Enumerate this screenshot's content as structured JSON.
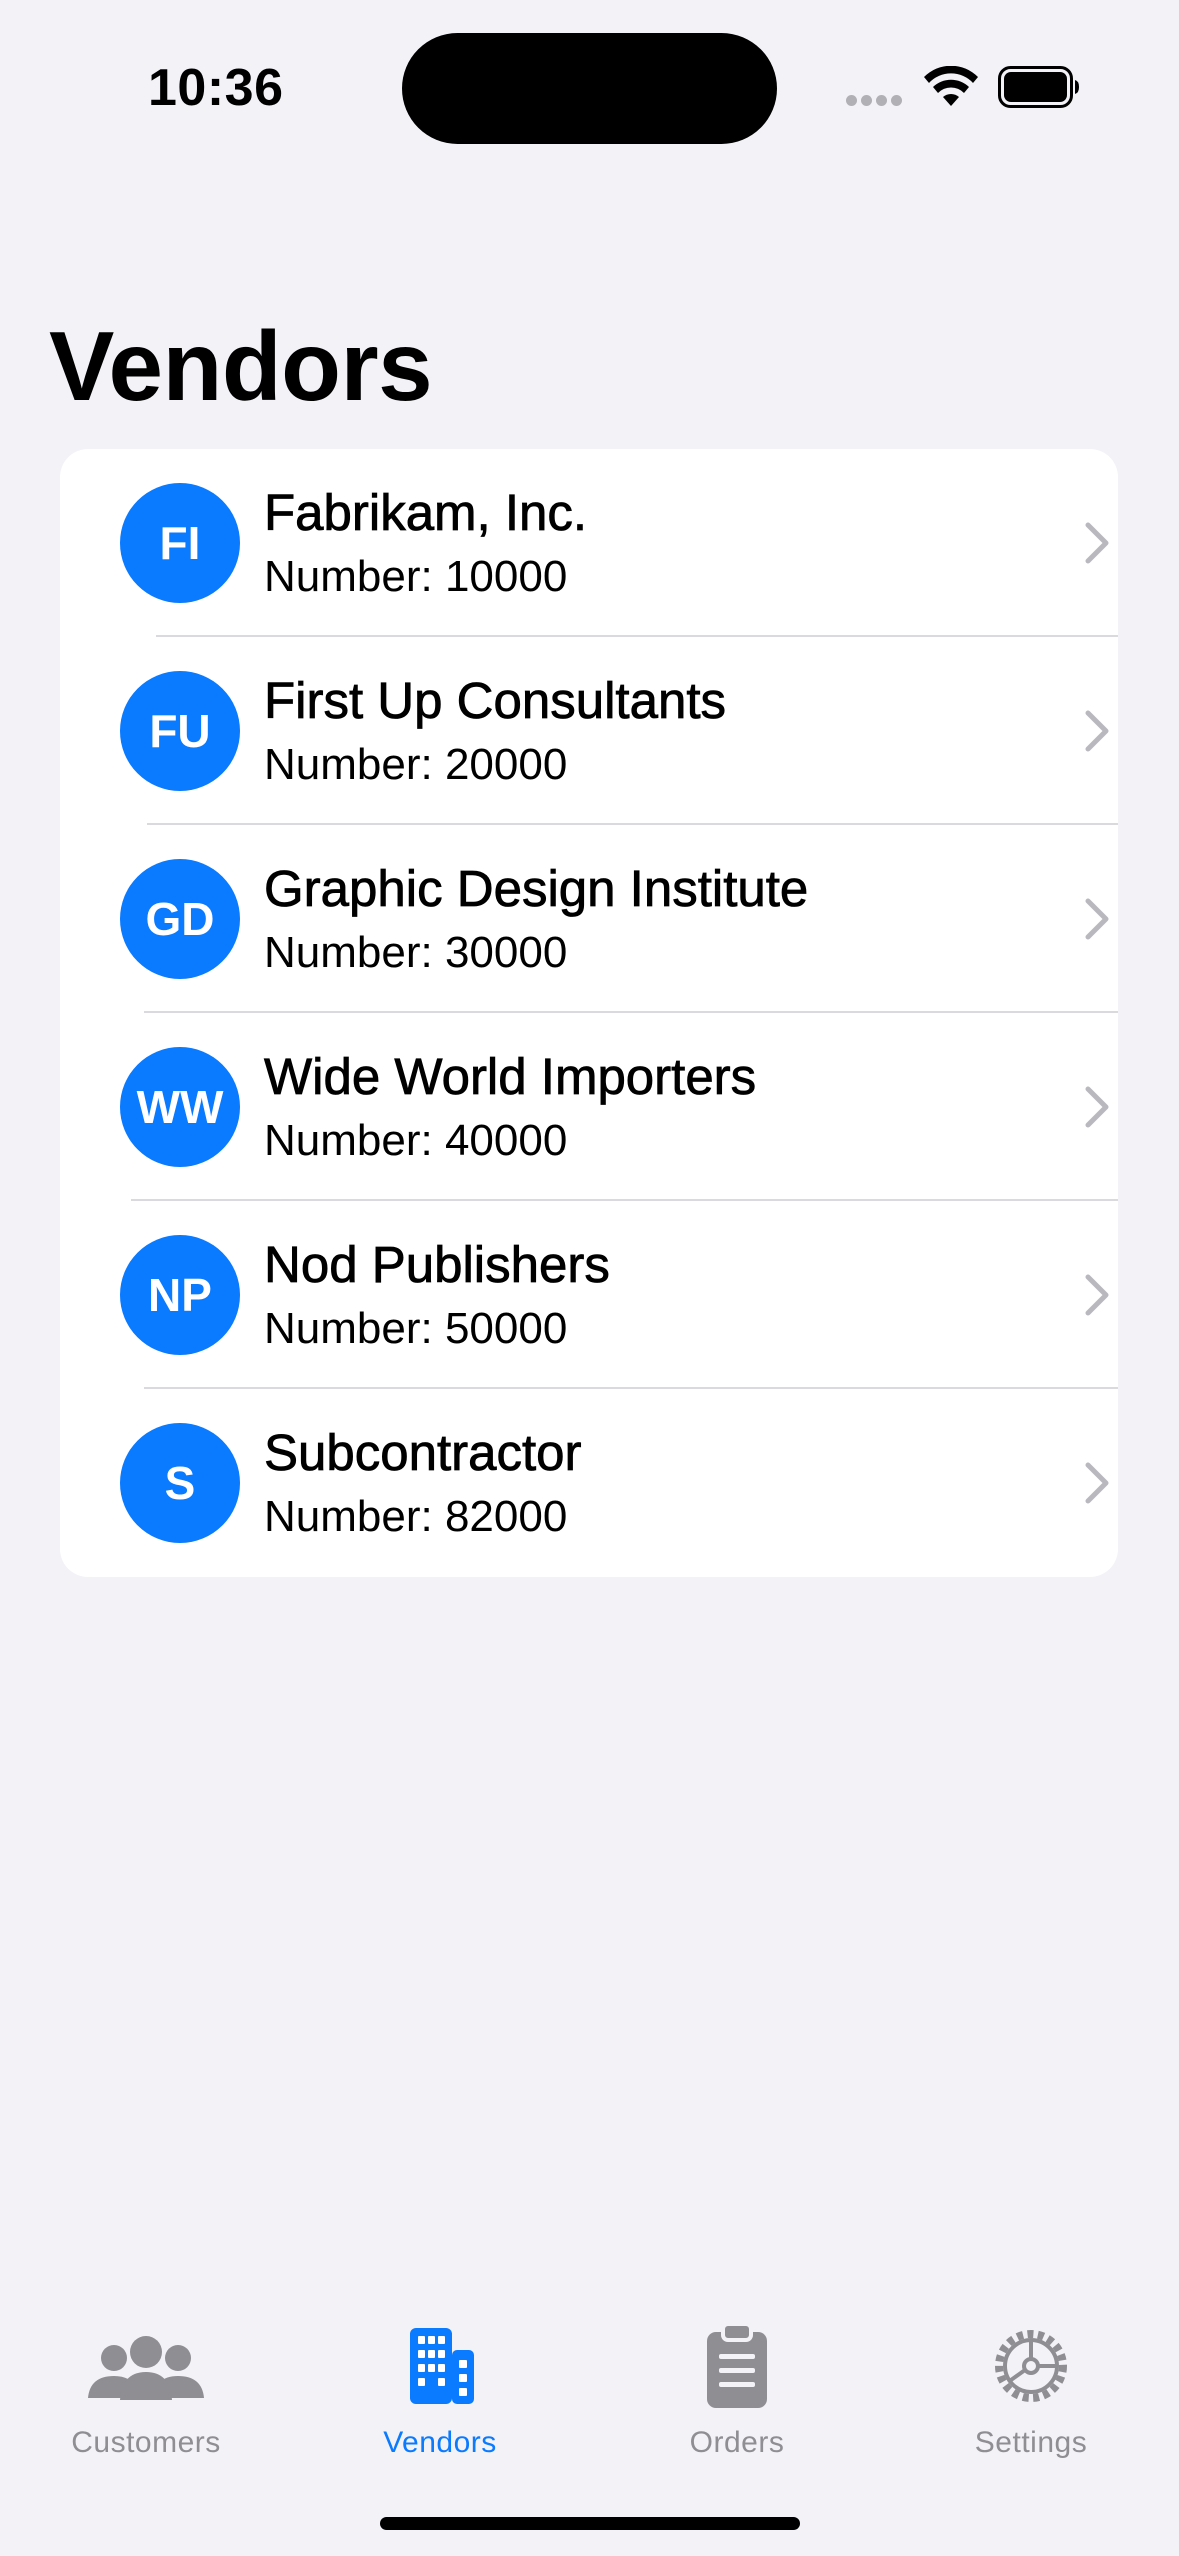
{
  "status_bar": {
    "time": "10:36"
  },
  "page": {
    "title": "Vendors"
  },
  "vendors": [
    {
      "initials": "FI",
      "name": "Fabrikam, Inc.",
      "number": "Number: 10000"
    },
    {
      "initials": "FU",
      "name": "First Up Consultants",
      "number": "Number: 20000"
    },
    {
      "initials": "GD",
      "name": "Graphic Design Institute",
      "number": "Number: 30000"
    },
    {
      "initials": "WW",
      "name": "Wide World Importers",
      "number": "Number: 40000"
    },
    {
      "initials": "NP",
      "name": "Nod Publishers",
      "number": "Number: 50000"
    },
    {
      "initials": "S",
      "name": "Subcontractor",
      "number": "Number: 82000"
    }
  ],
  "tabs": [
    {
      "label": "Customers",
      "icon": "people-icon",
      "active": false
    },
    {
      "label": "Vendors",
      "icon": "building-icon",
      "active": true
    },
    {
      "label": "Orders",
      "icon": "clipboard-icon",
      "active": false
    },
    {
      "label": "Settings",
      "icon": "gear-icon",
      "active": false
    }
  ],
  "colors": {
    "accent": "#0A7AFF",
    "inactive": "#8E8E93",
    "background": "#F2F2F7"
  }
}
